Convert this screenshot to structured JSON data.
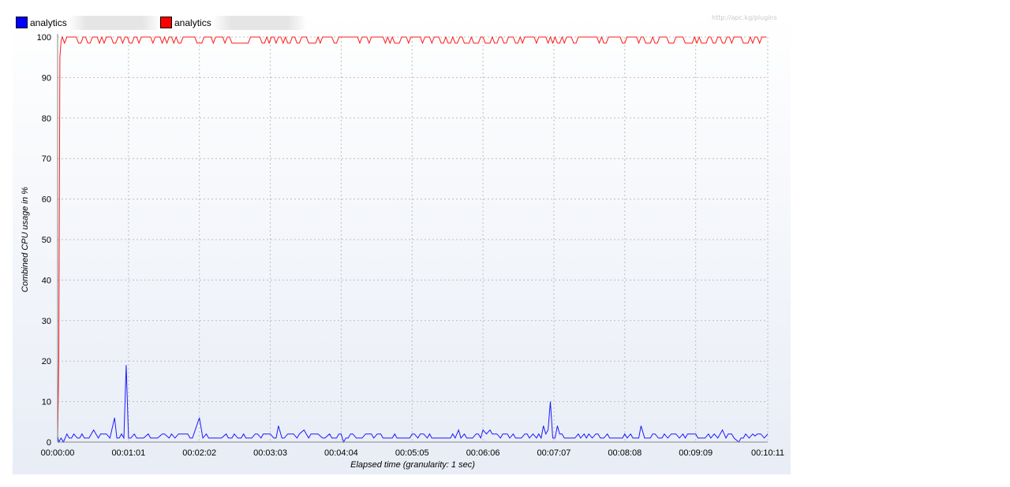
{
  "chart_data": {
    "type": "line",
    "xlabel": "Elapsed time (granularity: 1 sec)",
    "ylabel": "Combined CPU usage in %",
    "ylim": [
      0,
      100
    ],
    "y_ticks": [
      0,
      10,
      20,
      30,
      40,
      50,
      60,
      70,
      80,
      90,
      100
    ],
    "x_range_sec": [
      0,
      611
    ],
    "x_ticks": [
      {
        "sec": 0,
        "label": "00:00:00"
      },
      {
        "sec": 61,
        "label": "00:01:01"
      },
      {
        "sec": 122,
        "label": "00:02:02"
      },
      {
        "sec": 183,
        "label": "00:03:03"
      },
      {
        "sec": 244,
        "label": "00:04:04"
      },
      {
        "sec": 305,
        "label": "00:05:05"
      },
      {
        "sec": 366,
        "label": "00:06:06"
      },
      {
        "sec": 427,
        "label": "00:07:07"
      },
      {
        "sec": 488,
        "label": "00:08:08"
      },
      {
        "sec": 549,
        "label": "00:09:09"
      },
      {
        "sec": 611,
        "label": "00:10:11"
      }
    ],
    "grid": true,
    "legend_position": "top-left",
    "series": [
      {
        "name": "analytics",
        "color": "#1a1aff",
        "baseline": 1.5,
        "points": [
          [
            0,
            1.5
          ],
          [
            1,
            0
          ],
          [
            3,
            1
          ],
          [
            5,
            0
          ],
          [
            8,
            2
          ],
          [
            10,
            1
          ],
          [
            14,
            2
          ],
          [
            17,
            1
          ],
          [
            21,
            2
          ],
          [
            27,
            1
          ],
          [
            31,
            3
          ],
          [
            35,
            1
          ],
          [
            40,
            2
          ],
          [
            45,
            1
          ],
          [
            49,
            6
          ],
          [
            51,
            1
          ],
          [
            55,
            2
          ],
          [
            57,
            1
          ],
          [
            59,
            19
          ],
          [
            61,
            1
          ],
          [
            66,
            2
          ],
          [
            72,
            1
          ],
          [
            78,
            2
          ],
          [
            84,
            1
          ],
          [
            90,
            2
          ],
          [
            96,
            1
          ],
          [
            104,
            2
          ],
          [
            112,
            2
          ],
          [
            116,
            1
          ],
          [
            122,
            6
          ],
          [
            125,
            1
          ],
          [
            128,
            2
          ],
          [
            136,
            1
          ],
          [
            145,
            2
          ],
          [
            150,
            1
          ],
          [
            160,
            2
          ],
          [
            165,
            1
          ],
          [
            170,
            2
          ],
          [
            175,
            1
          ],
          [
            183,
            2
          ],
          [
            186,
            1
          ],
          [
            190,
            4
          ],
          [
            193,
            1
          ],
          [
            198,
            2
          ],
          [
            206,
            1
          ],
          [
            212,
            3
          ],
          [
            216,
            1
          ],
          [
            222,
            2
          ],
          [
            228,
            1
          ],
          [
            234,
            2
          ],
          [
            240,
            1
          ],
          [
            244,
            2
          ],
          [
            246,
            0
          ],
          [
            248,
            1
          ],
          [
            252,
            2
          ],
          [
            260,
            1
          ],
          [
            270,
            2
          ],
          [
            280,
            1
          ],
          [
            290,
            2
          ],
          [
            298,
            1
          ],
          [
            305,
            2
          ],
          [
            310,
            1
          ],
          [
            320,
            2
          ],
          [
            330,
            1
          ],
          [
            340,
            2
          ],
          [
            345,
            3
          ],
          [
            350,
            2
          ],
          [
            355,
            1
          ],
          [
            362,
            2
          ],
          [
            366,
            3
          ],
          [
            369,
            2
          ],
          [
            372,
            3
          ],
          [
            376,
            2
          ],
          [
            381,
            1
          ],
          [
            387,
            2
          ],
          [
            394,
            1
          ],
          [
            404,
            2
          ],
          [
            414,
            2
          ],
          [
            416,
            1
          ],
          [
            418,
            4
          ],
          [
            420,
            2
          ],
          [
            422,
            3
          ],
          [
            424,
            10
          ],
          [
            426,
            1
          ],
          [
            430,
            4
          ],
          [
            434,
            2
          ],
          [
            440,
            1
          ],
          [
            448,
            2
          ],
          [
            455,
            1
          ],
          [
            465,
            2
          ],
          [
            475,
            1
          ],
          [
            488,
            2
          ],
          [
            495,
            1
          ],
          [
            502,
            4
          ],
          [
            505,
            1
          ],
          [
            512,
            2
          ],
          [
            520,
            1
          ],
          [
            530,
            2
          ],
          [
            540,
            1
          ],
          [
            549,
            2
          ],
          [
            555,
            1
          ],
          [
            560,
            2
          ],
          [
            568,
            1
          ],
          [
            572,
            3
          ],
          [
            575,
            1
          ],
          [
            580,
            2
          ],
          [
            586,
            0
          ],
          [
            590,
            1
          ],
          [
            600,
            1.5
          ],
          [
            611,
            2
          ]
        ]
      },
      {
        "name": "analytics",
        "color": "#ff1a1a",
        "baseline": 98.5,
        "points": [
          [
            0,
            0
          ],
          [
            1,
            20
          ],
          [
            2,
            95
          ],
          [
            3,
            99
          ],
          [
            7,
            100
          ],
          [
            60,
            100
          ],
          [
            200,
            100
          ],
          [
            611,
            100
          ]
        ]
      }
    ]
  },
  "legend": {
    "items": [
      {
        "label": "analytics",
        "color": "#0000ff"
      },
      {
        "label": "analytics",
        "color": "#ff0000"
      }
    ]
  },
  "watermark": "http://apc.kg/plugins"
}
